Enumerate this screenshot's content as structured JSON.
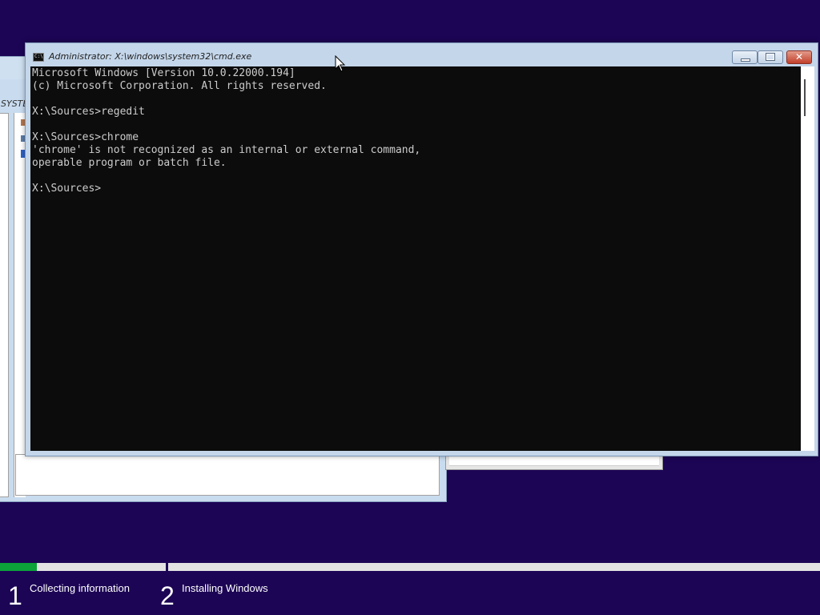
{
  "cmd_window": {
    "title": "Administrator: X:\\windows\\system32\\cmd.exe",
    "icon_label": "C:\\",
    "buttons": {
      "minimize": "minimize",
      "maximize": "restore",
      "close": "✕"
    },
    "console_lines": [
      "Microsoft Windows [Version 10.0.22000.194]",
      "(c) Microsoft Corporation. All rights reserved.",
      "",
      "X:\\Sources>regedit",
      "",
      "X:\\Sources>chrome",
      "'chrome' is not recognized as an internal or external command,",
      "operable program or batch file.",
      "",
      "X:\\Sources>"
    ]
  },
  "background_window": {
    "address_fragment": "SYSTEM"
  },
  "setup_progress": {
    "fill_fraction_of_step1": 0.22,
    "fill_color": "#0ba33a",
    "steps": [
      {
        "number": "1",
        "label": "Collecting information"
      },
      {
        "number": "2",
        "label": "Installing Windows"
      }
    ]
  },
  "colors": {
    "desktop": "#1c0555",
    "console_bg": "#0c0c0c",
    "console_fg": "#cccccc"
  }
}
